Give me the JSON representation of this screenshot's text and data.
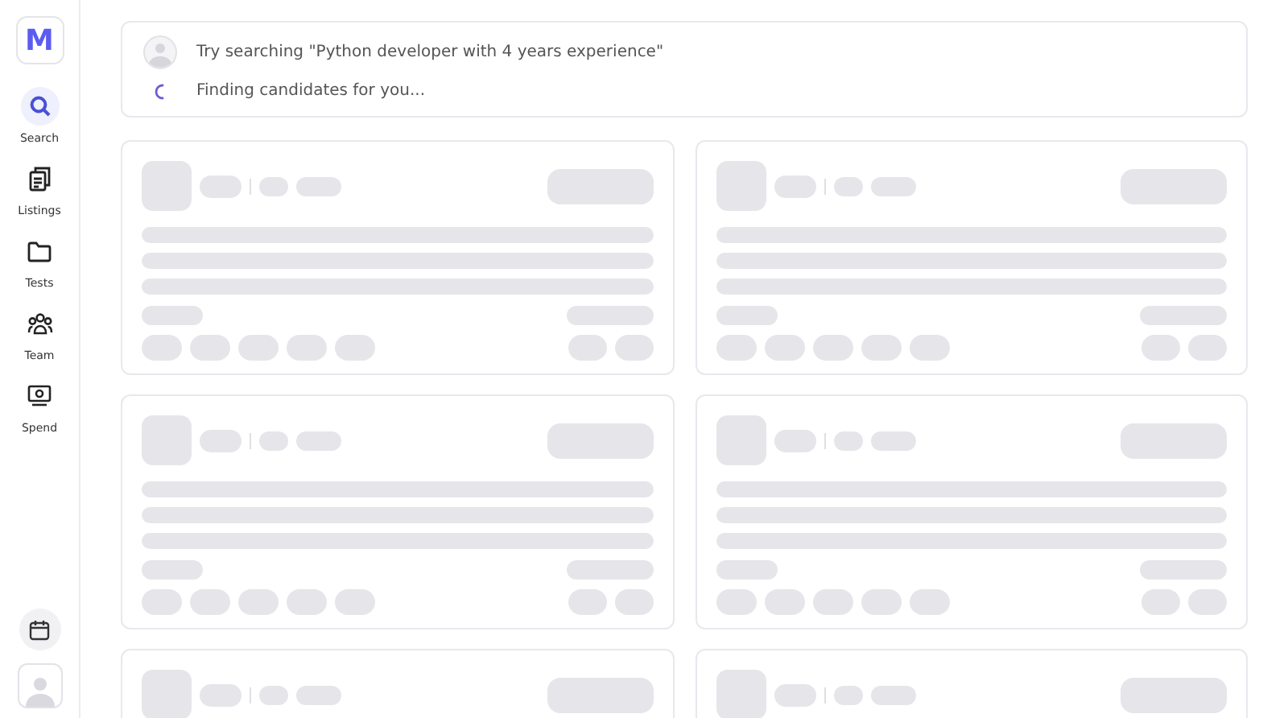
{
  "sidebar": {
    "logo": "M",
    "items": [
      {
        "kind": "search",
        "label": "Search",
        "selected": true
      },
      {
        "kind": "listings",
        "label": "Listings",
        "selected": false
      },
      {
        "kind": "tests",
        "label": "Tests",
        "selected": false
      },
      {
        "kind": "team",
        "label": "Team",
        "selected": false
      },
      {
        "kind": "spend",
        "label": "Spend",
        "selected": false
      }
    ]
  },
  "search_panel": {
    "prompt": "Try searching \"Python developer with 4 years experience\"",
    "status": "Finding candidates for you..."
  },
  "results": [
    {
      "kind": "skeleton"
    },
    {
      "kind": "skeleton"
    },
    {
      "kind": "skeleton"
    },
    {
      "kind": "skeleton"
    },
    {
      "kind": "skeleton"
    },
    {
      "kind": "skeleton"
    }
  ]
}
